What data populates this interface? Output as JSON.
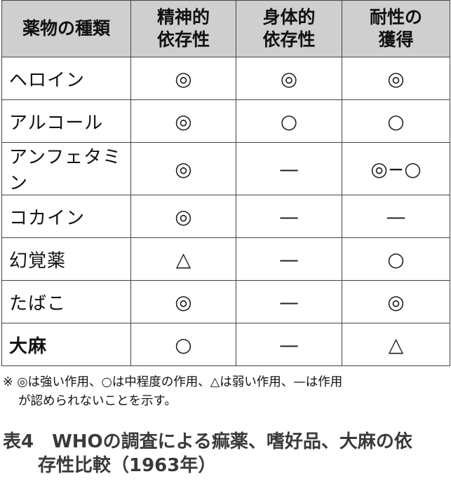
{
  "table": {
    "headers": [
      "薬物の種類",
      "精神的\n依存性",
      "身体的\n依存性",
      "耐性の\n獲得"
    ],
    "rows": [
      {
        "name": "ヘロイン",
        "psychological": "◎",
        "physical": "◎",
        "tolerance": "◎"
      },
      {
        "name": "アルコール",
        "psychological": "◎",
        "physical": "○",
        "tolerance": "○"
      },
      {
        "name": "アンフェタミン",
        "psychological": "◎",
        "physical": "—",
        "tolerance": "◎−○"
      },
      {
        "name": "コカイン",
        "psychological": "◎",
        "physical": "—",
        "tolerance": "—"
      },
      {
        "name": "幻覚薬",
        "psychological": "△",
        "physical": "—",
        "tolerance": "○"
      },
      {
        "name": "たばこ",
        "psychological": "◎",
        "physical": "—",
        "tolerance": "◎"
      },
      {
        "name": "大麻",
        "psychological": "○",
        "physical": "—",
        "tolerance": "△"
      }
    ]
  },
  "note": {
    "line1": "※ ◎は強い作用、○は中程度の作用、△は弱い作用、—は作用",
    "line2": "が認められないことを示す。"
  },
  "caption": {
    "line1": "表4　WHOの調査による痲薬、嗜好品、大麻の依",
    "line2": "存性比較（1963年）"
  }
}
